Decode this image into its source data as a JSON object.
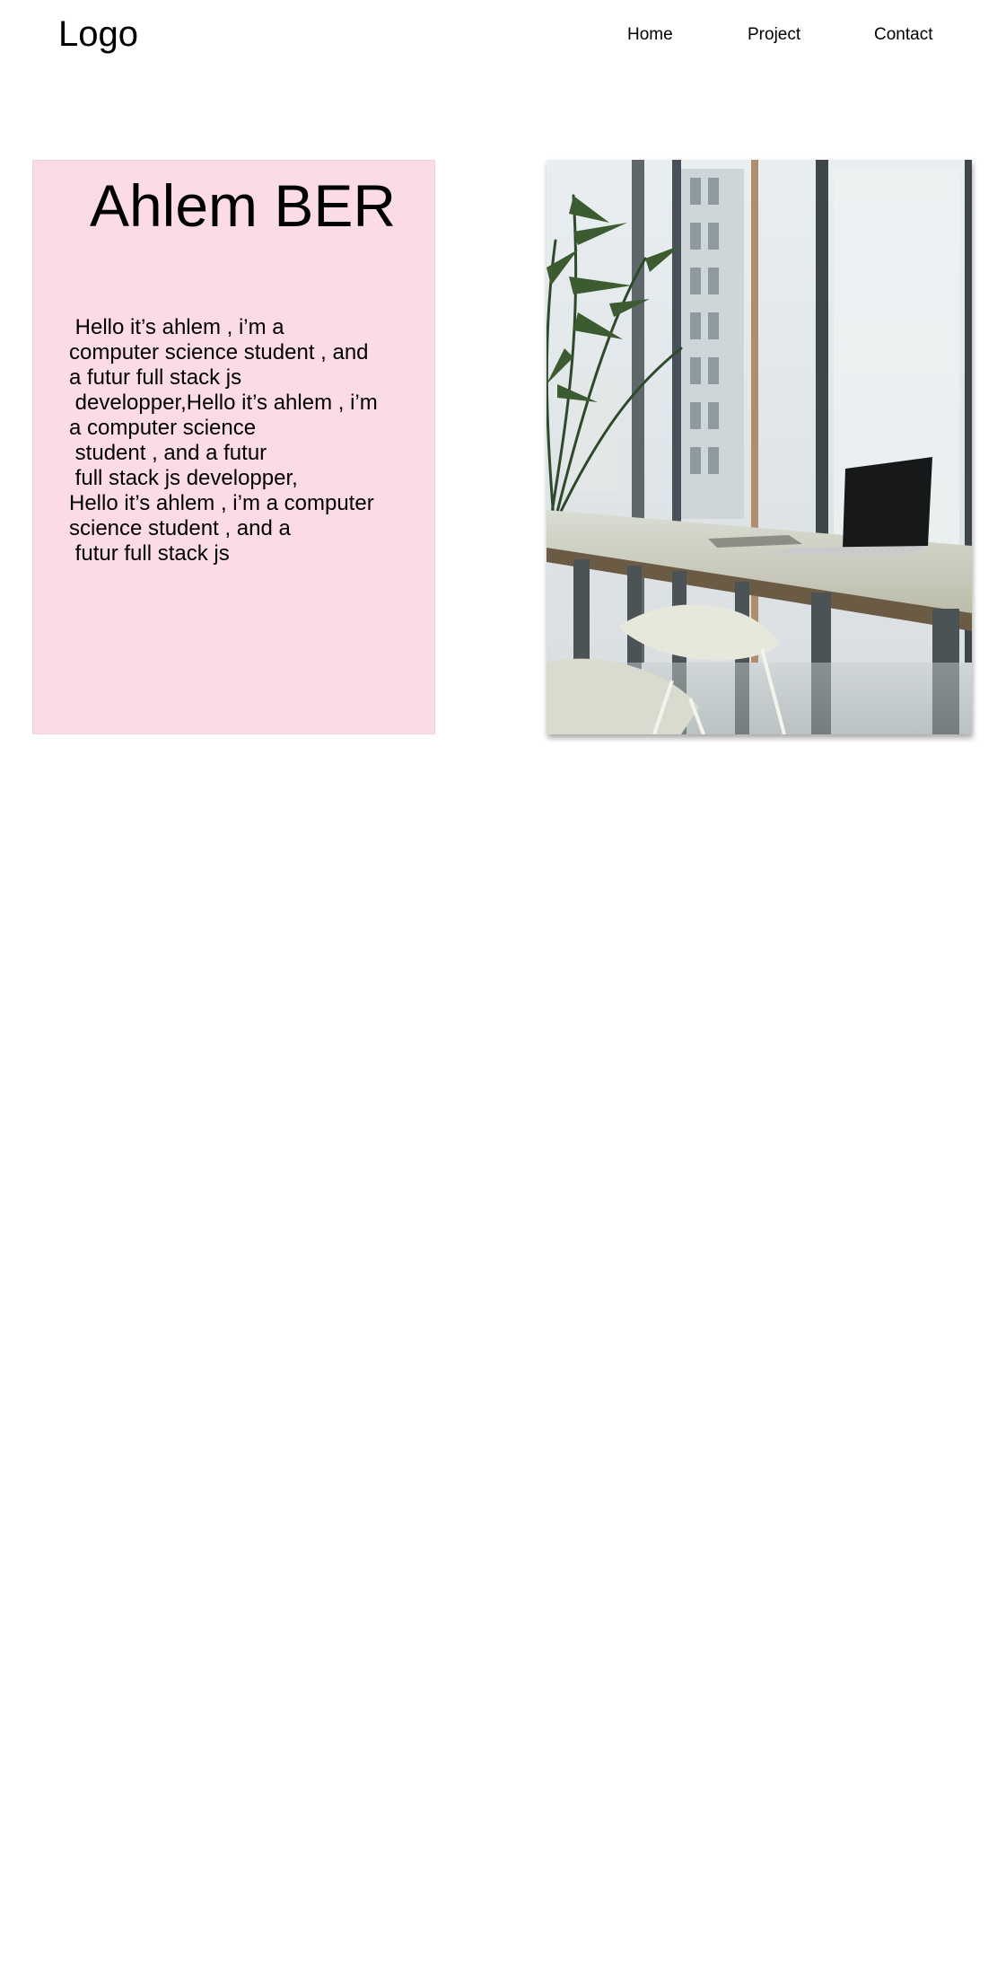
{
  "header": {
    "logo": "Logo",
    "nav": [
      "Home",
      "Project",
      "Contact"
    ]
  },
  "intro": {
    "name": "Ahlem BER",
    "text": " Hello it’s ahlem , i’m a\ncomputer science student , and\na futur full stack js\n developper,Hello it’s ahlem , i’m\na computer science\n student , and a futur\n full stack js developper,\nHello it’s ahlem , i’m a computer\nscience student , and a\n futur full stack js"
  },
  "photo": {
    "subject": "office desk with laptop by window"
  },
  "colors": {
    "card_background": "#fcdbe9",
    "text": "#000000",
    "page_background": "#ffffff"
  }
}
